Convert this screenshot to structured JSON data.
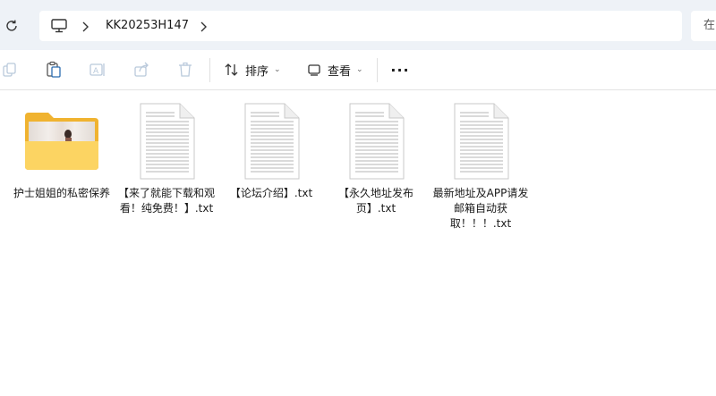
{
  "address": {
    "path": [
      "KK20253H147"
    ],
    "search_placeholder": "在"
  },
  "toolbar": {
    "sort_label": "排序",
    "view_label": "查看",
    "more_label": "···"
  },
  "files": [
    {
      "name": "护士姐姐的私密保养",
      "type": "folder"
    },
    {
      "name": "【来了就能下载和观看！纯免费！】.txt",
      "type": "txt"
    },
    {
      "name": "【论坛介绍】.txt",
      "type": "txt"
    },
    {
      "name": "【永久地址发布页】.txt",
      "type": "txt"
    },
    {
      "name": "最新地址及APP请发邮箱自动获取！！！.txt",
      "type": "txt"
    }
  ],
  "colors": {
    "address_bg": "#eef2f7",
    "folder_back": "#f0b330",
    "folder_front": "#fcd462",
    "accent": "#0067c0"
  },
  "icons": {
    "refresh": "refresh-icon",
    "this_pc": "monitor-icon",
    "copy": "copy-icon",
    "paste": "paste-icon",
    "rename": "rename-icon",
    "share": "share-icon",
    "delete": "trash-icon",
    "sort": "sort-icon",
    "view": "view-icon"
  }
}
